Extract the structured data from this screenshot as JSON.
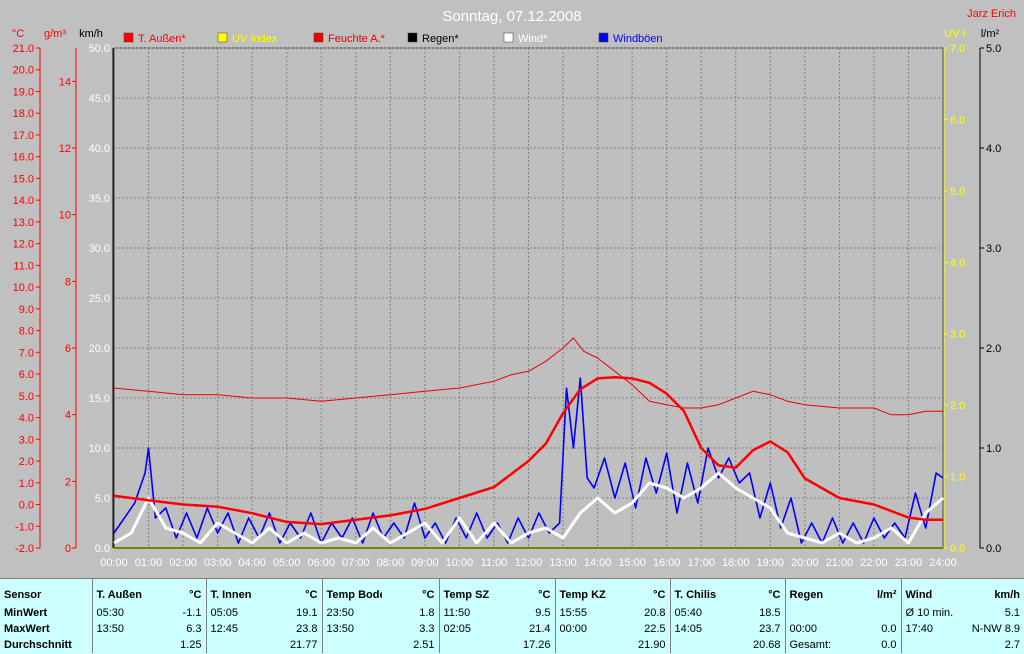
{
  "title": "Sonntag, 07.12.2008",
  "author": "Jarz Erich",
  "colors": {
    "t_aussen": "#ff0000",
    "uv_index": "#ffff00",
    "feuchte": "#ee0000",
    "regen": "#000000",
    "wind": "#ffffff",
    "windboeen": "#0000ff",
    "plot_bg": "#bfbfbf",
    "grid": "#808080"
  },
  "axes": {
    "celsius_unit": "°C",
    "gm3_unit": "g/m³",
    "kmh_unit": "km/h",
    "uvi_unit": "UV-I",
    "lm2_unit": "l/m²",
    "celsius_ticks": [
      "21.0",
      "20.0",
      "19.0",
      "18.0",
      "17.0",
      "16.0",
      "15.0",
      "14.0",
      "13.0",
      "12.0",
      "11.0",
      "10.0",
      "9.0",
      "8.0",
      "7.0",
      "6.0",
      "5.0",
      "4.0",
      "3.0",
      "2.0",
      "1.0",
      "0.0",
      "-1.0",
      "-2.0"
    ],
    "gm3_ticks": [
      "14",
      "12",
      "10",
      "8",
      "6",
      "4",
      "2",
      "0"
    ],
    "kmh_ticks": [
      "50.0",
      "45.0",
      "40.0",
      "35.0",
      "30.0",
      "25.0",
      "20.0",
      "15.0",
      "10.0",
      "5.0",
      "0.0"
    ],
    "uvi_ticks": [
      "7.0",
      "6.0",
      "5.0",
      "4.0",
      "3.0",
      "2.0",
      "1.0",
      "0.0"
    ],
    "lm2_ticks": [
      "5.0",
      "4.0",
      "3.0",
      "2.0",
      "1.0",
      "0.0"
    ],
    "x_ticks": [
      "00:00",
      "01:00",
      "02:00",
      "03:00",
      "04:00",
      "05:00",
      "06:00",
      "07:00",
      "08:00",
      "09:00",
      "10:00",
      "11:00",
      "12:00",
      "13:00",
      "14:00",
      "15:00",
      "16:00",
      "17:00",
      "18:00",
      "19:00",
      "20:00",
      "21:00",
      "22:00",
      "23:00",
      "24:00"
    ]
  },
  "legend": [
    {
      "label": "T. Außen*",
      "color": "#ff0000"
    },
    {
      "label": "UV Index",
      "color": "#ffff00"
    },
    {
      "label": "Feuchte A.*",
      "color": "#ee0000"
    },
    {
      "label": "Regen*",
      "color": "#000000"
    },
    {
      "label": "Wind*",
      "color": "#ffffff"
    },
    {
      "label": "Windböen",
      "color": "#0000ff"
    }
  ],
  "chart_data": {
    "type": "line",
    "title": "Sonntag, 07.12.2008",
    "x_unit": "hour of day",
    "xlim": [
      0,
      24
    ],
    "grid": true,
    "legend_position": "top",
    "series": [
      {
        "name": "T. Außen*",
        "axis": "°C",
        "ylim": [
          -2,
          21
        ],
        "x": [
          0,
          1,
          2,
          3,
          4,
          5,
          6,
          7,
          8,
          9,
          10,
          11,
          12,
          12.5,
          13,
          13.5,
          14,
          14.5,
          15,
          15.5,
          16,
          16.5,
          17,
          17.5,
          18,
          18.5,
          19,
          19.5,
          20,
          21,
          22,
          23,
          23.5,
          24
        ],
        "values": [
          0.4,
          0.2,
          0.0,
          -0.1,
          -0.4,
          -0.8,
          -0.9,
          -0.7,
          -0.5,
          -0.2,
          0.3,
          0.8,
          2.0,
          2.8,
          4.2,
          5.3,
          5.8,
          5.85,
          5.8,
          5.6,
          5.1,
          4.3,
          2.6,
          1.8,
          1.7,
          2.5,
          2.9,
          2.4,
          1.2,
          0.3,
          0.0,
          -0.6,
          -0.7,
          -0.7
        ]
      },
      {
        "name": "Feuchte A.*",
        "axis": "g/m³",
        "ylim": [
          0,
          15
        ],
        "x": [
          0,
          1,
          2,
          3,
          4,
          5,
          6,
          7,
          8,
          9,
          10,
          11,
          11.5,
          12,
          12.5,
          13,
          13.3,
          13.6,
          14,
          14.5,
          15,
          15.5,
          16,
          16.5,
          17,
          17.5,
          18,
          18.5,
          19,
          19.5,
          20,
          21,
          22,
          22.5,
          23,
          23.5,
          24
        ],
        "values": [
          4.8,
          4.7,
          4.6,
          4.6,
          4.5,
          4.5,
          4.4,
          4.5,
          4.6,
          4.7,
          4.8,
          5.0,
          5.2,
          5.3,
          5.6,
          6.0,
          6.3,
          5.9,
          5.7,
          5.3,
          4.9,
          4.4,
          4.3,
          4.2,
          4.2,
          4.3,
          4.5,
          4.7,
          4.6,
          4.4,
          4.3,
          4.2,
          4.2,
          4.0,
          4.0,
          4.1,
          4.1
        ]
      },
      {
        "name": "Wind*",
        "axis": "km/h",
        "ylim": [
          0,
          50
        ],
        "x": [
          0,
          0.5,
          1,
          1.5,
          2,
          2.5,
          3,
          3.5,
          4,
          4.5,
          5,
          5.5,
          6,
          6.5,
          7,
          7.5,
          8,
          8.5,
          9,
          9.5,
          10,
          10.5,
          11,
          11.5,
          12,
          12.5,
          13,
          13.5,
          14,
          14.5,
          15,
          15.5,
          16,
          16.5,
          17,
          17.5,
          18,
          18.5,
          19,
          19.5,
          20,
          20.5,
          21,
          21.5,
          22,
          22.5,
          23,
          23.5,
          24
        ],
        "values": [
          0.5,
          1.5,
          5.0,
          2.0,
          1.5,
          0.5,
          2.5,
          1.5,
          0.5,
          2.0,
          0.5,
          1.5,
          0.5,
          1.0,
          0.5,
          2.0,
          0.5,
          1.5,
          2.5,
          0.5,
          3.0,
          0.5,
          2.5,
          0.5,
          1.5,
          2.0,
          1.0,
          3.5,
          5.0,
          3.5,
          4.5,
          6.5,
          6.0,
          5.0,
          6.0,
          7.5,
          6.0,
          5.0,
          4.0,
          1.5,
          1.0,
          0.5,
          1.5,
          0.5,
          1.0,
          2.0,
          0.5,
          3.5,
          5.0
        ]
      },
      {
        "name": "Windböen",
        "axis": "km/h",
        "ylim": [
          0,
          50
        ],
        "x": [
          0,
          0.3,
          0.6,
          0.9,
          1.0,
          1.2,
          1.5,
          1.8,
          2.1,
          2.4,
          2.7,
          3.0,
          3.3,
          3.6,
          3.9,
          4.2,
          4.5,
          4.8,
          5.1,
          5.4,
          5.7,
          6.0,
          6.3,
          6.6,
          6.9,
          7.2,
          7.5,
          7.8,
          8.1,
          8.4,
          8.7,
          9.0,
          9.3,
          9.6,
          9.9,
          10.2,
          10.5,
          10.8,
          11.1,
          11.4,
          11.7,
          12.0,
          12.3,
          12.6,
          12.9,
          13.1,
          13.3,
          13.5,
          13.7,
          13.9,
          14.2,
          14.5,
          14.8,
          15.1,
          15.4,
          15.7,
          16.0,
          16.3,
          16.6,
          16.9,
          17.2,
          17.5,
          17.8,
          18.1,
          18.4,
          18.7,
          19.0,
          19.3,
          19.6,
          19.9,
          20.2,
          20.5,
          20.8,
          21.1,
          21.4,
          21.7,
          22.0,
          22.3,
          22.6,
          22.9,
          23.2,
          23.5,
          23.8,
          24
        ],
        "values": [
          1.5,
          3.0,
          4.5,
          7.5,
          10.0,
          3.0,
          4.0,
          1.0,
          3.5,
          1.0,
          4.0,
          1.5,
          3.5,
          0.5,
          3.0,
          1.0,
          3.5,
          0.5,
          2.5,
          1.0,
          3.5,
          0.5,
          2.5,
          1.0,
          3.0,
          0.5,
          3.5,
          1.0,
          2.5,
          1.0,
          4.5,
          1.0,
          2.5,
          0.5,
          3.0,
          1.0,
          3.5,
          1.0,
          2.5,
          0.5,
          3.0,
          1.0,
          3.5,
          1.5,
          2.5,
          16.0,
          10.0,
          17.0,
          7.0,
          6.0,
          9.0,
          5.0,
          8.5,
          4.0,
          9.0,
          5.5,
          9.5,
          3.5,
          8.5,
          4.5,
          10.0,
          7.0,
          9.0,
          6.5,
          7.5,
          3.0,
          6.5,
          2.0,
          5.0,
          0.5,
          2.5,
          0.5,
          3.0,
          0.5,
          2.5,
          0.5,
          3.0,
          1.0,
          2.5,
          1.0,
          5.5,
          2.0,
          7.5,
          7.0
        ]
      },
      {
        "name": "UV Index",
        "axis": "UV-I",
        "ylim": [
          0,
          7
        ],
        "x": [
          0,
          24
        ],
        "values": [
          0.0,
          0.0
        ]
      },
      {
        "name": "Regen*",
        "axis": "l/m²",
        "ylim": [
          0,
          5
        ],
        "x": [
          0,
          24
        ],
        "values": [
          0.0,
          0.0
        ]
      }
    ]
  },
  "stats": {
    "row_labels": {
      "sensor": "Sensor",
      "min": "MinWert",
      "max": "MaxWert",
      "avg": "Durchschnitt"
    },
    "columns": [
      {
        "name": "T. Außen",
        "unit": "°C",
        "min_time": "05:30",
        "min": "-1.1",
        "max_time": "13:50",
        "max": "6.3",
        "avg": "1.25"
      },
      {
        "name": "T. Innen",
        "unit": "°C",
        "min_time": "05:05",
        "min": "19.1",
        "max_time": "12:45",
        "max": "23.8",
        "avg": "21.77"
      },
      {
        "name": "Temp Boden",
        "unit": "°C",
        "min_time": "23:50",
        "min": "1.8",
        "max_time": "13:50",
        "max": "3.3",
        "avg": "2.51"
      },
      {
        "name": "Temp SZ",
        "unit": "°C",
        "min_time": "11:50",
        "min": "9.5",
        "max_time": "02:05",
        "max": "21.4",
        "avg": "17.26"
      },
      {
        "name": "Temp KZ",
        "unit": "°C",
        "min_time": "15:55",
        "min": "20.8",
        "max_time": "00:00",
        "max": "22.5",
        "avg": "21.90"
      },
      {
        "name": "T. Chilis",
        "unit": "°C",
        "min_time": "05:40",
        "min": "18.5",
        "max_time": "14:05",
        "max": "23.7",
        "avg": "20.68"
      },
      {
        "name": "Regen",
        "unit": "l/m²",
        "min_time": "",
        "min": "",
        "max_time": "00:00",
        "max": "0.0",
        "avg_label": "Gesamt:",
        "avg": "0.0"
      },
      {
        "name": "Wind",
        "unit": "km/h",
        "min_time": "Ø 10 min.",
        "min": "5.1",
        "max_time": "17:40",
        "max": "N-NW 8.9",
        "avg": "2.7"
      }
    ]
  }
}
